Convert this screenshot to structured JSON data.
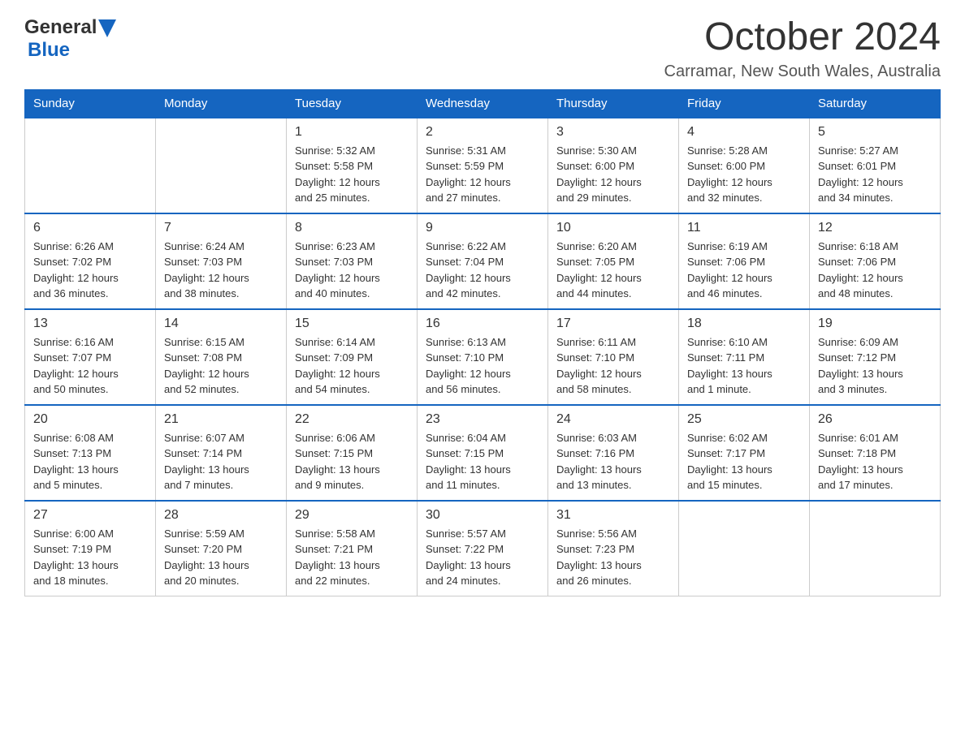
{
  "header": {
    "logo": {
      "text_general": "General",
      "text_blue": "Blue",
      "alt": "GeneralBlue logo"
    },
    "title": "October 2024",
    "location": "Carramar, New South Wales, Australia"
  },
  "calendar": {
    "days_of_week": [
      "Sunday",
      "Monday",
      "Tuesday",
      "Wednesday",
      "Thursday",
      "Friday",
      "Saturday"
    ],
    "weeks": [
      [
        {
          "day": "",
          "info": ""
        },
        {
          "day": "",
          "info": ""
        },
        {
          "day": "1",
          "info": "Sunrise: 5:32 AM\nSunset: 5:58 PM\nDaylight: 12 hours\nand 25 minutes."
        },
        {
          "day": "2",
          "info": "Sunrise: 5:31 AM\nSunset: 5:59 PM\nDaylight: 12 hours\nand 27 minutes."
        },
        {
          "day": "3",
          "info": "Sunrise: 5:30 AM\nSunset: 6:00 PM\nDaylight: 12 hours\nand 29 minutes."
        },
        {
          "day": "4",
          "info": "Sunrise: 5:28 AM\nSunset: 6:00 PM\nDaylight: 12 hours\nand 32 minutes."
        },
        {
          "day": "5",
          "info": "Sunrise: 5:27 AM\nSunset: 6:01 PM\nDaylight: 12 hours\nand 34 minutes."
        }
      ],
      [
        {
          "day": "6",
          "info": "Sunrise: 6:26 AM\nSunset: 7:02 PM\nDaylight: 12 hours\nand 36 minutes."
        },
        {
          "day": "7",
          "info": "Sunrise: 6:24 AM\nSunset: 7:03 PM\nDaylight: 12 hours\nand 38 minutes."
        },
        {
          "day": "8",
          "info": "Sunrise: 6:23 AM\nSunset: 7:03 PM\nDaylight: 12 hours\nand 40 minutes."
        },
        {
          "day": "9",
          "info": "Sunrise: 6:22 AM\nSunset: 7:04 PM\nDaylight: 12 hours\nand 42 minutes."
        },
        {
          "day": "10",
          "info": "Sunrise: 6:20 AM\nSunset: 7:05 PM\nDaylight: 12 hours\nand 44 minutes."
        },
        {
          "day": "11",
          "info": "Sunrise: 6:19 AM\nSunset: 7:06 PM\nDaylight: 12 hours\nand 46 minutes."
        },
        {
          "day": "12",
          "info": "Sunrise: 6:18 AM\nSunset: 7:06 PM\nDaylight: 12 hours\nand 48 minutes."
        }
      ],
      [
        {
          "day": "13",
          "info": "Sunrise: 6:16 AM\nSunset: 7:07 PM\nDaylight: 12 hours\nand 50 minutes."
        },
        {
          "day": "14",
          "info": "Sunrise: 6:15 AM\nSunset: 7:08 PM\nDaylight: 12 hours\nand 52 minutes."
        },
        {
          "day": "15",
          "info": "Sunrise: 6:14 AM\nSunset: 7:09 PM\nDaylight: 12 hours\nand 54 minutes."
        },
        {
          "day": "16",
          "info": "Sunrise: 6:13 AM\nSunset: 7:10 PM\nDaylight: 12 hours\nand 56 minutes."
        },
        {
          "day": "17",
          "info": "Sunrise: 6:11 AM\nSunset: 7:10 PM\nDaylight: 12 hours\nand 58 minutes."
        },
        {
          "day": "18",
          "info": "Sunrise: 6:10 AM\nSunset: 7:11 PM\nDaylight: 13 hours\nand 1 minute."
        },
        {
          "day": "19",
          "info": "Sunrise: 6:09 AM\nSunset: 7:12 PM\nDaylight: 13 hours\nand 3 minutes."
        }
      ],
      [
        {
          "day": "20",
          "info": "Sunrise: 6:08 AM\nSunset: 7:13 PM\nDaylight: 13 hours\nand 5 minutes."
        },
        {
          "day": "21",
          "info": "Sunrise: 6:07 AM\nSunset: 7:14 PM\nDaylight: 13 hours\nand 7 minutes."
        },
        {
          "day": "22",
          "info": "Sunrise: 6:06 AM\nSunset: 7:15 PM\nDaylight: 13 hours\nand 9 minutes."
        },
        {
          "day": "23",
          "info": "Sunrise: 6:04 AM\nSunset: 7:15 PM\nDaylight: 13 hours\nand 11 minutes."
        },
        {
          "day": "24",
          "info": "Sunrise: 6:03 AM\nSunset: 7:16 PM\nDaylight: 13 hours\nand 13 minutes."
        },
        {
          "day": "25",
          "info": "Sunrise: 6:02 AM\nSunset: 7:17 PM\nDaylight: 13 hours\nand 15 minutes."
        },
        {
          "day": "26",
          "info": "Sunrise: 6:01 AM\nSunset: 7:18 PM\nDaylight: 13 hours\nand 17 minutes."
        }
      ],
      [
        {
          "day": "27",
          "info": "Sunrise: 6:00 AM\nSunset: 7:19 PM\nDaylight: 13 hours\nand 18 minutes."
        },
        {
          "day": "28",
          "info": "Sunrise: 5:59 AM\nSunset: 7:20 PM\nDaylight: 13 hours\nand 20 minutes."
        },
        {
          "day": "29",
          "info": "Sunrise: 5:58 AM\nSunset: 7:21 PM\nDaylight: 13 hours\nand 22 minutes."
        },
        {
          "day": "30",
          "info": "Sunrise: 5:57 AM\nSunset: 7:22 PM\nDaylight: 13 hours\nand 24 minutes."
        },
        {
          "day": "31",
          "info": "Sunrise: 5:56 AM\nSunset: 7:23 PM\nDaylight: 13 hours\nand 26 minutes."
        },
        {
          "day": "",
          "info": ""
        },
        {
          "day": "",
          "info": ""
        }
      ]
    ]
  }
}
